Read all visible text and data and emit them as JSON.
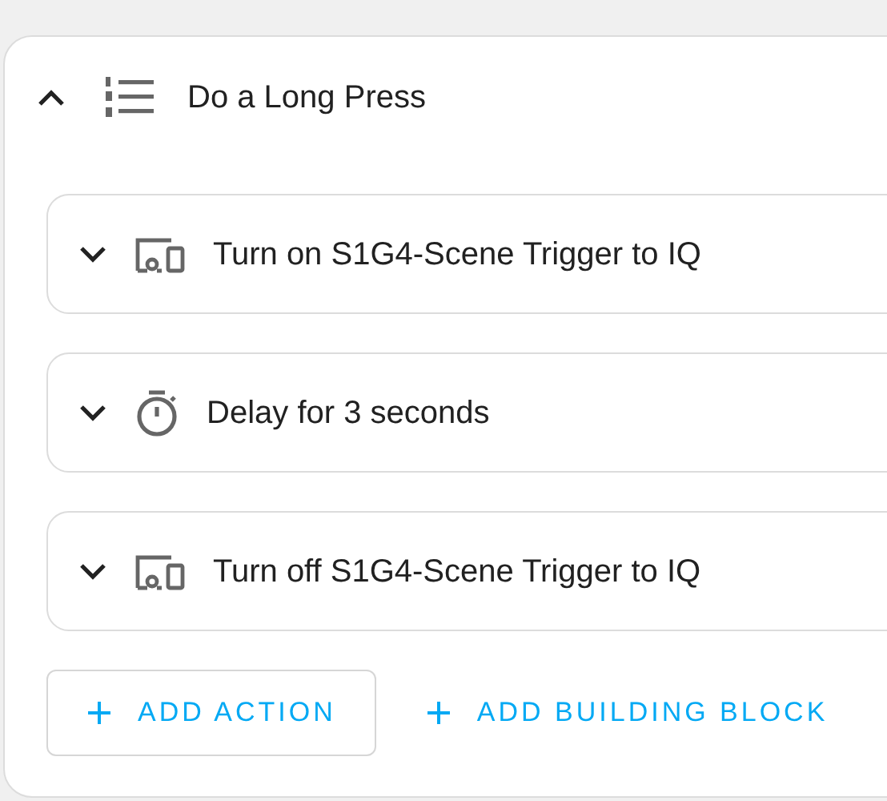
{
  "sequence": {
    "title": "Do a Long Press",
    "expanded": true,
    "actions": [
      {
        "kind": "device",
        "label": "Turn on S1G4-Scene Trigger to IQ",
        "expanded": false
      },
      {
        "kind": "delay",
        "label": "Delay for 3 seconds",
        "expanded": false
      },
      {
        "kind": "device",
        "label": "Turn off S1G4-Scene Trigger to IQ",
        "expanded": false
      }
    ],
    "buttons": [
      {
        "kind": "outlined",
        "label": "ADD ACTION"
      },
      {
        "kind": "text",
        "label": "ADD BUILDING BLOCK"
      }
    ]
  }
}
